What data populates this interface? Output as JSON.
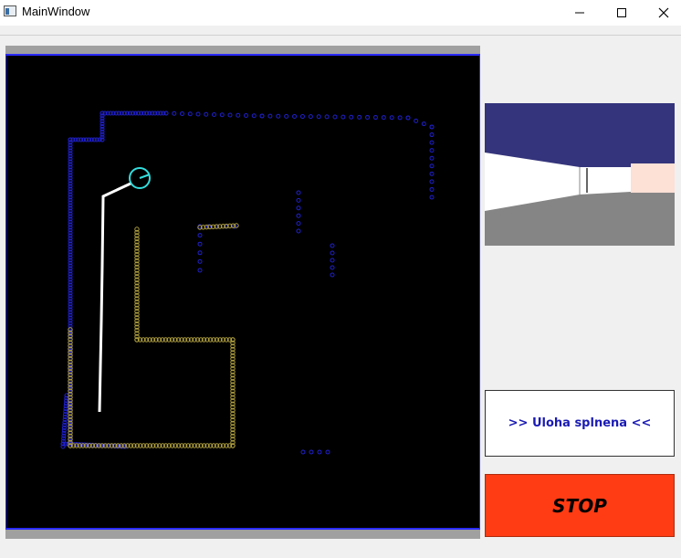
{
  "window": {
    "title": "MainWindow",
    "icons": [
      "app-icon",
      "minimize-icon",
      "maximize-icon",
      "close-icon"
    ]
  },
  "colors": {
    "map_background": "#000000",
    "map_border": "#2a2aff",
    "wall_points": "#2020cc",
    "sensed_points": "#b0a040",
    "robot": "#33dddd",
    "trajectory": "#ffffff",
    "stop_button": "#ff3c14",
    "status_text": "#1a1ab4",
    "camera_ceiling": "#34347c",
    "camera_floor": "#858585"
  },
  "status": {
    "message": ">> Uloha splnena <<"
  },
  "controls": {
    "stop_label": "STOP"
  }
}
